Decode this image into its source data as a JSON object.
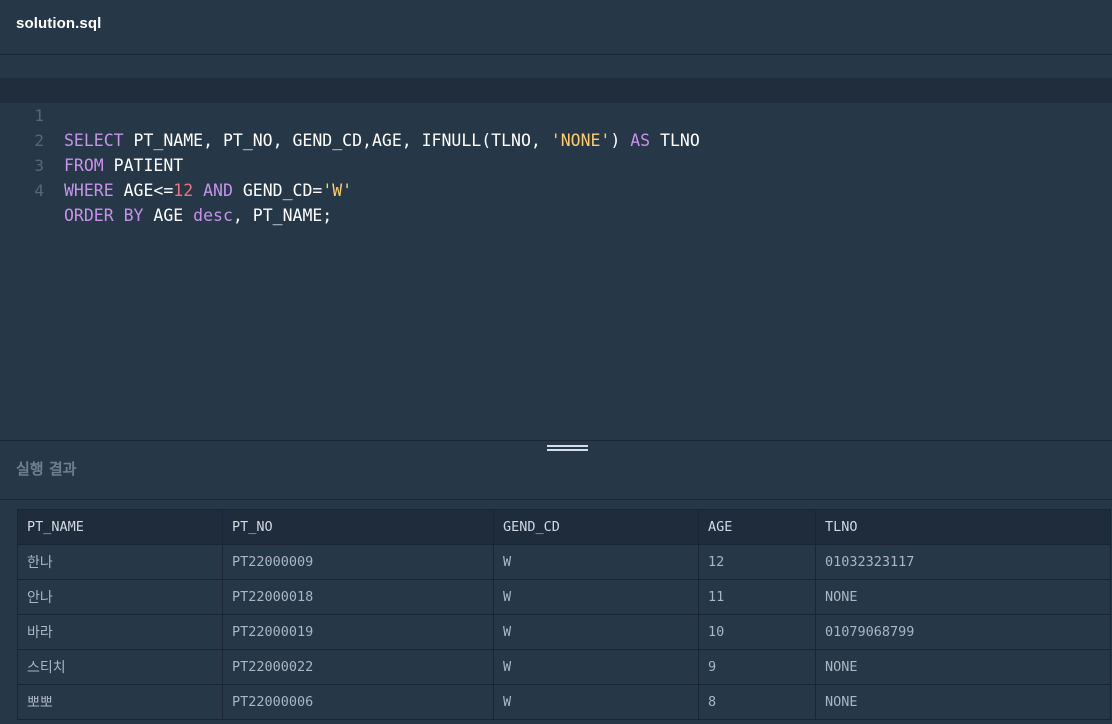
{
  "tab": {
    "filename": "solution.sql"
  },
  "editor": {
    "lines": [
      {
        "number": "1",
        "text": "SELECT PT_NAME, PT_NO, GEND_CD,AGE, IFNULL(TLNO, 'NONE') AS TLNO"
      },
      {
        "number": "2",
        "text": "FROM PATIENT"
      },
      {
        "number": "3",
        "text": "WHERE AGE<=12 AND GEND_CD='W'"
      },
      {
        "number": "4",
        "text": "ORDER BY AGE desc, PT_NAME;"
      }
    ]
  },
  "results": {
    "title": "실행 결과",
    "columns": [
      "PT_NAME",
      "PT_NO",
      "GEND_CD",
      "AGE",
      "TLNO"
    ],
    "rows": [
      [
        "한나",
        "PT22000009",
        "W",
        "12",
        "01032323117"
      ],
      [
        "안나",
        "PT22000018",
        "W",
        "11",
        "NONE"
      ],
      [
        "바라",
        "PT22000019",
        "W",
        "10",
        "01079068799"
      ],
      [
        "스티치",
        "PT22000022",
        "W",
        "9",
        "NONE"
      ],
      [
        "뽀뽀",
        "PT22000006",
        "W",
        "8",
        "NONE"
      ]
    ]
  },
  "colors": {
    "background": "#263747",
    "keyword": "#c792ea",
    "string": "#ffcb6b",
    "number": "#f07178"
  }
}
